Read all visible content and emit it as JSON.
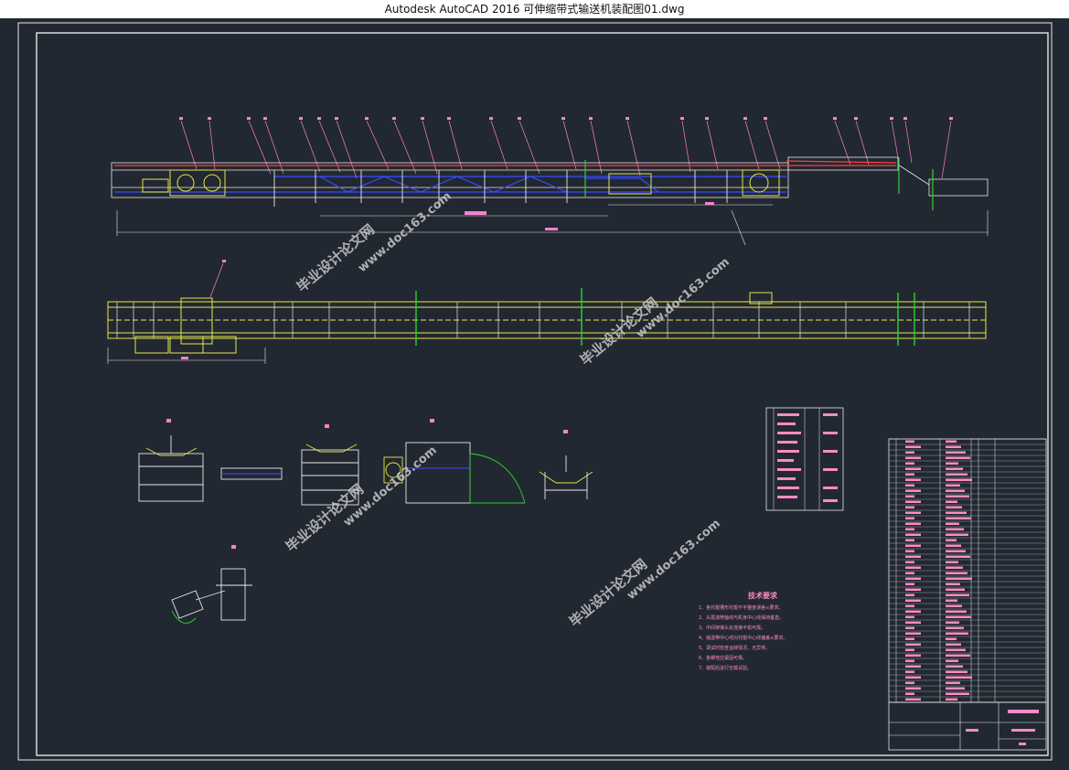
{
  "window": {
    "title": "Autodesk AutoCAD 2016     可伸缩带式输送机装配图01.dwg"
  },
  "drawing": {
    "tech_title": "技术要求",
    "tech_lines": [
      "1、各托辊槽形托辊不平整度误差≤要求。",
      "2、头尾滚筒轴线与机身中心线保持垂直。",
      "3、中间架接头处连接平稳可靠。",
      "4、输送带中心线对托辊中心线偏差≤要求。",
      "5、调试时检查运转情况，无异常。",
      "6、各螺栓应紧固可靠。",
      "7、装配后进行空载试验。"
    ],
    "watermarks": [
      "毕业设计论文网",
      "www.doc163.com"
    ],
    "colors": {
      "background": "#222831",
      "frame": "#ffffff",
      "structure_yellow": "#e6e64a",
      "structure_white": "#e8e8e8",
      "dimension_magenta": "#ff7fd0",
      "belt_blue": "#3b4cff",
      "belt_red": "#ff4040",
      "note_pink": "#ff8ac4",
      "green": "#2fd12f",
      "watermark": "#c9c9c9"
    }
  }
}
